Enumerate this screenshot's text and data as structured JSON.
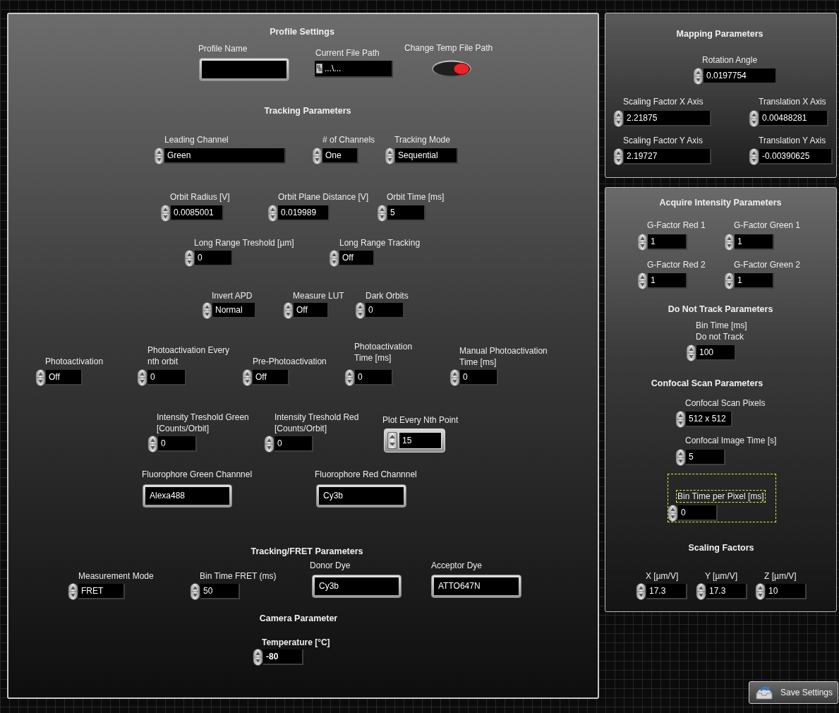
{
  "panels": [
    {
      "items": [
        {
          "kind": "heading",
          "text": "Profile Settings"
        },
        {
          "kind": "string",
          "label": "Profile Name",
          "value": "",
          "selected": false
        },
        {
          "kind": "path",
          "label": "Current File Path",
          "value": "...\\...",
          "selected": false
        },
        {
          "kind": "toggle",
          "label": "Change Temp File Path",
          "on": true,
          "selected": false
        },
        {
          "kind": "heading",
          "text": "Tracking Parameters"
        },
        {
          "kind": "numeric",
          "label": "Leading Channel",
          "value": "Green",
          "selected": false
        },
        {
          "kind": "numeric",
          "label": "# of Channels",
          "value": "One",
          "selected": false
        },
        {
          "kind": "numeric",
          "label": "Tracking Mode",
          "value": "Sequential",
          "selected": false
        },
        {
          "kind": "numeric",
          "label": "Orbit Radius [V]",
          "value": "0.0085001",
          "selected": false
        },
        {
          "kind": "numeric",
          "label": "Orbit Plane Distance [V]",
          "value": "0.019989",
          "selected": false
        },
        {
          "kind": "numeric",
          "label": "Orbit Time [ms]",
          "value": "5",
          "selected": false
        },
        {
          "kind": "numeric",
          "label": "Long Range Treshold [µm]",
          "value": "0",
          "selected": false
        },
        {
          "kind": "numeric",
          "label": "Long Range Tracking",
          "value": "Off",
          "selected": false
        },
        {
          "kind": "numeric",
          "label": "Invert APD",
          "value": "Normal",
          "selected": false
        },
        {
          "kind": "numeric",
          "label": "Measure LUT",
          "value": "Off",
          "selected": false
        },
        {
          "kind": "numeric",
          "label": "Dark Orbits",
          "value": "0",
          "selected": false
        },
        {
          "kind": "numeric",
          "label": "Photoactivation",
          "value": "Off",
          "selected": false
        },
        {
          "kind": "numeric",
          "label": "Photoactivation Every\nnth orbit",
          "value": "0",
          "selected": false
        },
        {
          "kind": "numeric",
          "label": "Pre-Photoactivation",
          "value": "Off",
          "selected": false
        },
        {
          "kind": "numeric",
          "label": "Photoactivation\nTime [ms]",
          "value": "0",
          "selected": false
        },
        {
          "kind": "numeric",
          "label": "Manual Photoactivation\nTime [ms]",
          "value": "0",
          "selected": false
        },
        {
          "kind": "numeric",
          "label": "Intensity Treshold Green\n[Counts/Orbit]",
          "value": "0",
          "selected": false
        },
        {
          "kind": "numeric",
          "label": "Intensity Treshold Red\n[Counts/Orbit]",
          "value": "0",
          "selected": false
        },
        {
          "kind": "framed",
          "label": "Plot Every Nth Point",
          "value": "15",
          "selected": false
        },
        {
          "kind": "string",
          "label": "Fluorophore Green Channnel",
          "value": "Alexa488",
          "selected": false
        },
        {
          "kind": "string",
          "label": "Fluorophore Red Channnel",
          "value": "Cy3b",
          "selected": false
        },
        {
          "kind": "heading",
          "text": "Tracking/FRET Parameters"
        },
        {
          "kind": "numeric",
          "label": "Measurement Mode",
          "value": "FRET",
          "selected": false
        },
        {
          "kind": "numeric",
          "label": "Bin Time FRET (ms)",
          "value": "50",
          "selected": false
        },
        {
          "kind": "string",
          "label": "Donor Dye",
          "value": "Cy3b",
          "selected": false
        },
        {
          "kind": "string",
          "label": "Acceptor Dye",
          "value": "ATTO647N",
          "selected": false
        },
        {
          "kind": "heading",
          "text": "Camera Parameter"
        },
        {
          "kind": "emphasized",
          "label": "Temperature [°C]",
          "value": "-80",
          "selected": false
        }
      ]
    },
    {
      "items": [
        {
          "kind": "heading",
          "text": "Mapping Parameters"
        },
        {
          "kind": "numeric",
          "label": "Rotation Angle",
          "value": "0.0197754",
          "selected": false
        },
        {
          "kind": "numeric",
          "label": "Scaling Factor X Axis",
          "value": "2.21875",
          "selected": false
        },
        {
          "kind": "numeric",
          "label": "Translation X Axis",
          "value": "0.00488281",
          "selected": false
        },
        {
          "kind": "numeric",
          "label": "Scaling Factor Y Axis",
          "value": "2.19727",
          "selected": false
        },
        {
          "kind": "numeric",
          "label": "Translation Y Axis",
          "value": "-0.00390625",
          "selected": false
        }
      ]
    },
    {
      "items": [
        {
          "kind": "heading",
          "text": "Acquire Intensity Parameters"
        },
        {
          "kind": "numeric",
          "label": "G-Factor Red 1",
          "value": "1",
          "selected": false
        },
        {
          "kind": "numeric",
          "label": "G-Factor Green 1",
          "value": "1",
          "selected": false
        },
        {
          "kind": "numeric",
          "label": "G-Factor Red 2",
          "value": "1",
          "selected": false
        },
        {
          "kind": "numeric",
          "label": "G-Factor Green 2",
          "value": "1",
          "selected": false
        },
        {
          "kind": "heading",
          "text": "Do Not Track Parameters"
        },
        {
          "kind": "numeric",
          "label": "Bin Time [ms]\nDo not Track",
          "value": "100",
          "selected": false
        },
        {
          "kind": "heading",
          "text": "Confocal Scan Parameters"
        },
        {
          "kind": "numeric",
          "label": "Confocal Scan Pixels",
          "value": "512 x 512",
          "selected": false
        },
        {
          "kind": "numeric",
          "label": "Confocal Image Time [s]",
          "value": "5",
          "selected": false
        },
        {
          "kind": "numeric",
          "label": "Bin Time per Pixel [ms]",
          "value": "0",
          "selected": true
        },
        {
          "kind": "heading",
          "text": "Scaling Factors"
        },
        {
          "kind": "numeric",
          "label": "X [µm/V]",
          "value": "17.3",
          "selected": false
        },
        {
          "kind": "numeric",
          "label": "Y [µm/V]",
          "value": "17.3",
          "selected": false
        },
        {
          "kind": "numeric",
          "label": "Z [µm/V]",
          "value": "10",
          "selected": false
        }
      ]
    }
  ],
  "save_button": {
    "label": "Save Settings"
  }
}
